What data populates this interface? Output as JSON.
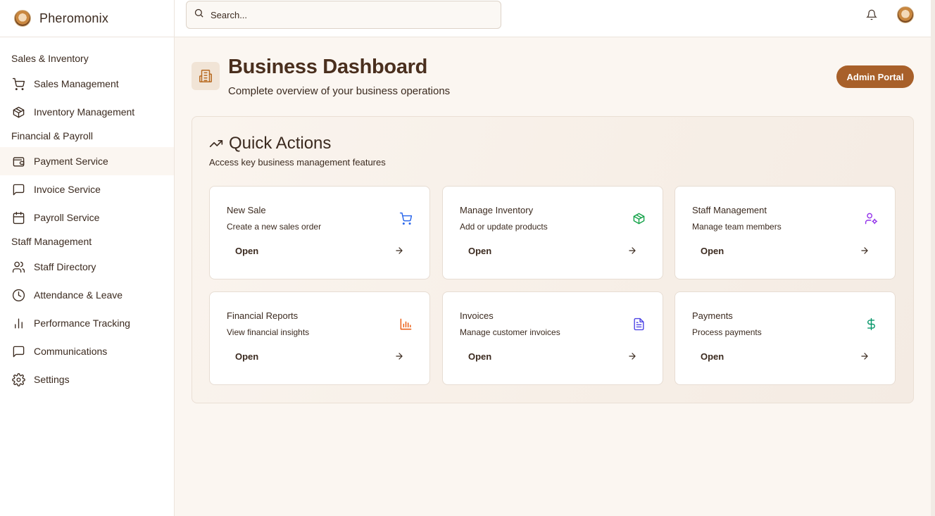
{
  "app": {
    "name": "Pheromonix"
  },
  "search": {
    "placeholder": "Search..."
  },
  "sidebar": {
    "sections": [
      {
        "title": "Sales & Inventory",
        "items": [
          {
            "label": "Sales Management",
            "icon": "cart-icon"
          },
          {
            "label": "Inventory Management",
            "icon": "package-icon"
          }
        ]
      },
      {
        "title": "Financial & Payroll",
        "items": [
          {
            "label": "Payment Service",
            "icon": "wallet-icon",
            "active": true
          },
          {
            "label": "Invoice Service",
            "icon": "message-square-icon"
          },
          {
            "label": "Payroll Service",
            "icon": "calendar-icon"
          }
        ]
      },
      {
        "title": "Staff Management",
        "items": [
          {
            "label": "Staff Directory",
            "icon": "users-icon"
          },
          {
            "label": "Attendance & Leave",
            "icon": "clock-icon"
          },
          {
            "label": "Performance Tracking",
            "icon": "bar-chart-icon"
          },
          {
            "label": "Communications",
            "icon": "message-square-icon"
          },
          {
            "label": "Settings",
            "icon": "gear-icon"
          }
        ]
      }
    ]
  },
  "header": {
    "title": "Business Dashboard",
    "subtitle": "Complete overview of your business operations",
    "admin_button": "Admin Portal"
  },
  "quick_actions": {
    "title": "Quick Actions",
    "subtitle": "Access key business management features",
    "cards": [
      {
        "title": "New Sale",
        "description": "Create a new sales order",
        "action": "Open",
        "icon": "cart-icon",
        "icon_color": "#2563eb"
      },
      {
        "title": "Manage Inventory",
        "description": "Add or update products",
        "action": "Open",
        "icon": "package-icon",
        "icon_color": "#16a34a"
      },
      {
        "title": "Staff Management",
        "description": "Manage team members",
        "action": "Open",
        "icon": "user-cog-icon",
        "icon_color": "#9333ea"
      },
      {
        "title": "Financial Reports",
        "description": "View financial insights",
        "action": "Open",
        "icon": "bar-chart-icon",
        "icon_color": "#ea580c"
      },
      {
        "title": "Invoices",
        "description": "Manage customer invoices",
        "action": "Open",
        "icon": "file-text-icon",
        "icon_color": "#4f46e5"
      },
      {
        "title": "Payments",
        "description": "Process payments",
        "action": "Open",
        "icon": "dollar-icon",
        "icon_color": "#059669"
      }
    ]
  },
  "colors": {
    "accent": "#a8602a",
    "text": "#3b2a1f",
    "background": "#fbf6f1"
  }
}
